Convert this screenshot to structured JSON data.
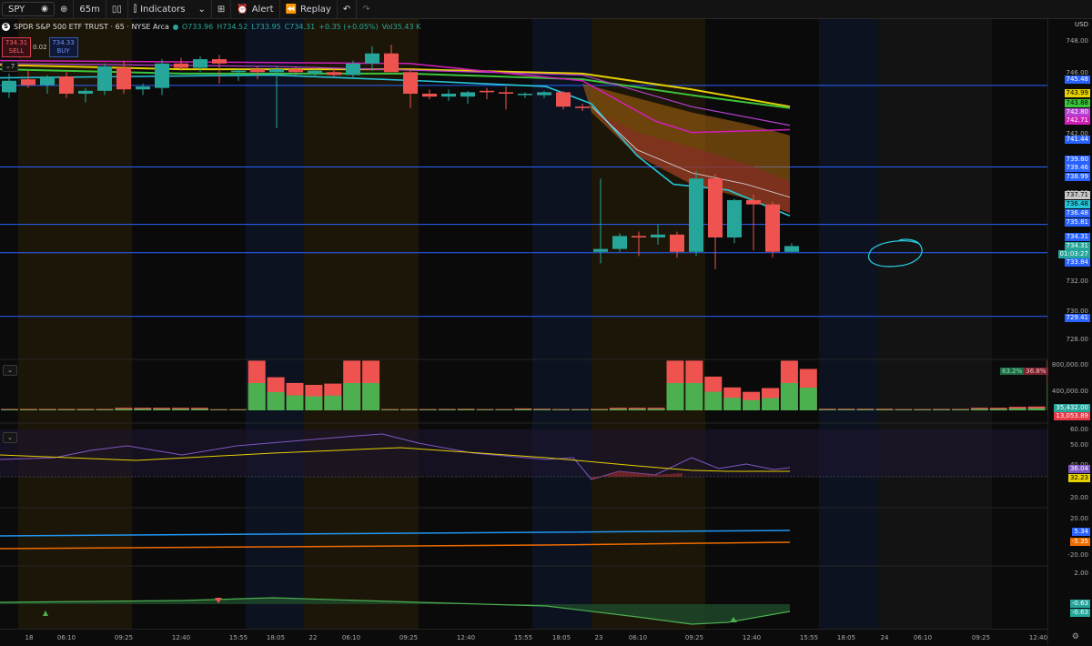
{
  "toolbar": {
    "symbol": "SPY",
    "interval": "65m",
    "indicators_label": "Indicators",
    "alert_label": "Alert",
    "replay_label": "Replay"
  },
  "legend": {
    "title": "SPDR S&P 500 ETF TRUST · 65 · NYSE Arca",
    "open": "O733.96",
    "high": "H734.52",
    "low": "L733.95",
    "close": "C734.31",
    "change": "+0.35 (+0.05%)",
    "volume": "Vol35.43 K"
  },
  "trade": {
    "sell_price": "734.31",
    "sell_label": "SELL",
    "spread": "0.02",
    "buy_price": "734.33",
    "buy_label": "BUY"
  },
  "pane_labels": {
    "main": "7"
  },
  "volume_ratio": {
    "buy": "63.2%",
    "sell": "36.8%"
  },
  "price_axis_labels": [
    "748.00",
    "746.00",
    "744.00",
    "742.00",
    "740.00",
    "738.00",
    "734.00",
    "732.00",
    "730.00",
    "728.00"
  ],
  "price_badges": [
    {
      "text": "745.48",
      "color": "#2962ff"
    },
    {
      "text": "743.99",
      "color": "#e6d000",
      "dark": true
    },
    {
      "text": "743.88",
      "color": "#3cc43c",
      "dark": true
    },
    {
      "text": "742.80",
      "color": "#b43fd0"
    },
    {
      "text": "742.71",
      "color": "#d01eb8"
    },
    {
      "text": "741.44",
      "color": "#2962ff"
    },
    {
      "text": "739.80",
      "color": "#2962ff"
    },
    {
      "text": "739.46",
      "color": "#2962ff"
    },
    {
      "text": "738.99",
      "color": "#2962ff"
    },
    {
      "text": "737.71",
      "color": "#c8c8c8",
      "dark": true
    },
    {
      "text": "736.48",
      "color": "#26c6da",
      "dark": true
    },
    {
      "text": "736.48",
      "color": "#2962ff"
    },
    {
      "text": "735.81",
      "color": "#2962ff"
    },
    {
      "text": "734.31",
      "color": "#2962ff"
    },
    {
      "text": "734.31",
      "color": "#26a69a"
    },
    {
      "text": "01:03:27",
      "color": "#26a69a"
    },
    {
      "text": "733.84",
      "color": "#2962ff"
    },
    {
      "text": "729.41",
      "color": "#2962ff"
    }
  ],
  "volume_axis": {
    "labels": [
      "800,000.00",
      "400,000.00"
    ],
    "badges": [
      {
        "text": "35,432.00",
        "color": "#26a69a"
      },
      {
        "text": "13,053.89",
        "color": "#e63946"
      }
    ]
  },
  "rsi_axis": {
    "labels": [
      "60.00",
      "50.00",
      "40.00",
      "20.00"
    ],
    "badges": [
      {
        "text": "36.04",
        "color": "#7e57c2"
      },
      {
        "text": "32.23",
        "color": "#e6d000",
        "dark": true
      }
    ]
  },
  "dmi_axis": {
    "labels": [
      "20.00",
      "-20.00"
    ],
    "badges": [
      {
        "text": "5.34",
        "color": "#2962ff"
      },
      {
        "text": "-5.35",
        "color": "#ef6c00"
      }
    ]
  },
  "osc_axis": {
    "labels": [
      "2.00"
    ],
    "badges": [
      {
        "text": "-0.63",
        "color": "#26a69a"
      },
      {
        "text": "-0.63",
        "color": "#26a69a"
      }
    ]
  },
  "time_labels": [
    "18",
    "06:10",
    "09:25",
    "12:40",
    "15:55",
    "18:05",
    "22",
    "06:10",
    "09:25",
    "12:40",
    "15:55",
    "18:05",
    "23",
    "06:10",
    "09:25",
    "12:40",
    "15:55",
    "18:05",
    "24",
    "06:10",
    "09:25",
    "12:40"
  ],
  "colors": {
    "up": "#26a69a",
    "down": "#ef5350",
    "level": "#2962ff",
    "ema_yellow": "#e6d000",
    "ema_green": "#3cc43c",
    "ema_magenta": "#d01eb8"
  },
  "chart_data": {
    "type": "candlestick",
    "interval": "65m",
    "candles": [
      {
        "o": 745.0,
        "h": 746.3,
        "l": 744.6,
        "c": 745.8
      },
      {
        "o": 745.9,
        "h": 746.5,
        "l": 745.3,
        "c": 745.5
      },
      {
        "o": 745.5,
        "h": 746.2,
        "l": 744.9,
        "c": 746.1
      },
      {
        "o": 746.1,
        "h": 746.4,
        "l": 744.6,
        "c": 744.9
      },
      {
        "o": 744.9,
        "h": 745.3,
        "l": 744.3,
        "c": 745.1
      },
      {
        "o": 745.1,
        "h": 747.0,
        "l": 744.8,
        "c": 746.8
      },
      {
        "o": 746.7,
        "h": 747.2,
        "l": 744.9,
        "c": 745.2
      },
      {
        "o": 745.2,
        "h": 745.6,
        "l": 744.8,
        "c": 745.4
      },
      {
        "o": 745.3,
        "h": 747.3,
        "l": 744.8,
        "c": 747.0
      },
      {
        "o": 747.0,
        "h": 747.4,
        "l": 746.5,
        "c": 746.7
      },
      {
        "o": 746.7,
        "h": 747.5,
        "l": 746.4,
        "c": 747.3
      },
      {
        "o": 747.3,
        "h": 747.6,
        "l": 745.6,
        "c": 747.0
      },
      {
        "o": 746.4,
        "h": 746.6,
        "l": 745.8,
        "c": 746.5
      },
      {
        "o": 746.6,
        "h": 746.8,
        "l": 745.9,
        "c": 746.4
      },
      {
        "o": 746.4,
        "h": 746.8,
        "l": 742.5,
        "c": 746.6
      },
      {
        "o": 746.6,
        "h": 746.8,
        "l": 746.2,
        "c": 746.4
      },
      {
        "o": 746.3,
        "h": 746.6,
        "l": 746.1,
        "c": 746.5
      },
      {
        "o": 746.4,
        "h": 746.6,
        "l": 746.1,
        "c": 746.2
      },
      {
        "o": 746.2,
        "h": 747.2,
        "l": 746.0,
        "c": 747.0
      },
      {
        "o": 747.0,
        "h": 748.2,
        "l": 746.5,
        "c": 747.7
      },
      {
        "o": 747.7,
        "h": 748.3,
        "l": 746.4,
        "c": 746.4
      },
      {
        "o": 746.4,
        "h": 746.6,
        "l": 743.9,
        "c": 744.9
      },
      {
        "o": 744.9,
        "h": 745.2,
        "l": 744.5,
        "c": 744.7
      },
      {
        "o": 744.7,
        "h": 745.2,
        "l": 744.4,
        "c": 744.9
      },
      {
        "o": 744.7,
        "h": 745.1,
        "l": 744.2,
        "c": 745.0
      },
      {
        "o": 745.1,
        "h": 745.3,
        "l": 744.5,
        "c": 745.0
      },
      {
        "o": 745.0,
        "h": 745.4,
        "l": 743.8,
        "c": 744.9
      },
      {
        "o": 744.8,
        "h": 745.0,
        "l": 744.6,
        "c": 744.9
      },
      {
        "o": 744.8,
        "h": 745.1,
        "l": 744.6,
        "c": 745.0
      },
      {
        "o": 745.0,
        "h": 745.1,
        "l": 743.8,
        "c": 744.0
      },
      {
        "o": 744.0,
        "h": 744.2,
        "l": 743.7,
        "c": 743.9
      },
      {
        "o": 733.9,
        "h": 739.0,
        "l": 733.1,
        "c": 734.1
      },
      {
        "o": 734.1,
        "h": 735.2,
        "l": 733.9,
        "c": 735.0
      },
      {
        "o": 735.0,
        "h": 735.3,
        "l": 733.6,
        "c": 734.9
      },
      {
        "o": 734.9,
        "h": 735.8,
        "l": 734.4,
        "c": 735.1
      },
      {
        "o": 735.1,
        "h": 735.3,
        "l": 733.5,
        "c": 733.9
      },
      {
        "o": 733.9,
        "h": 739.5,
        "l": 733.6,
        "c": 739.0
      },
      {
        "o": 739.0,
        "h": 739.3,
        "l": 732.7,
        "c": 734.9
      },
      {
        "o": 734.9,
        "h": 737.6,
        "l": 734.5,
        "c": 737.5
      },
      {
        "o": 737.5,
        "h": 737.9,
        "l": 734.0,
        "c": 737.2
      },
      {
        "o": 737.2,
        "h": 737.4,
        "l": 733.5,
        "c": 733.9
      },
      {
        "o": 733.9,
        "h": 734.5,
        "l": 733.9,
        "c": 734.3
      }
    ],
    "volume": [
      22000,
      22000,
      22000,
      22000,
      22000,
      22000,
      40000,
      40000,
      40000,
      40000,
      40000,
      18000,
      18000,
      780000,
      520000,
      430000,
      400000,
      420000,
      780000,
      780000,
      20000,
      20000,
      20000,
      22000,
      24000,
      20000,
      20000,
      30000,
      25000,
      20000,
      20000,
      22000,
      40000,
      40000,
      40000,
      780000,
      780000,
      530000,
      360000,
      290000,
      350000,
      780000,
      650000,
      25000,
      25000,
      25000,
      25000,
      20000,
      20000,
      22000,
      22000,
      40000,
      40000,
      55000,
      60000,
      780000,
      690000,
      440000,
      510000,
      620000,
      35432
    ],
    "indicators": [
      "EMA",
      "EMA",
      "EMA",
      "EMA",
      "Volume",
      "RSI",
      "DMI",
      "Oscillator"
    ]
  }
}
